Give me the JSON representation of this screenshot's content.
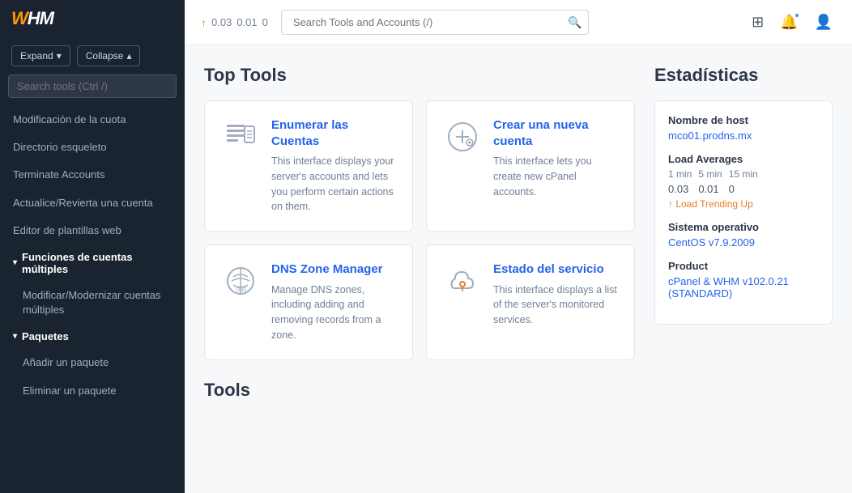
{
  "sidebar": {
    "logo": "WHM",
    "expand_label": "Expand",
    "collapse_label": "Collapse",
    "search_placeholder": "Search tools (Ctrl /)",
    "nav_items": [
      {
        "id": "modificacion-cuota",
        "label": "Modificación de la cuota",
        "type": "item"
      },
      {
        "id": "directorio-esqueleto",
        "label": "Directorio esqueleto",
        "type": "item"
      },
      {
        "id": "terminate-accounts",
        "label": "Terminate Accounts",
        "type": "item"
      },
      {
        "id": "actualice-revierta",
        "label": "Actualice/Revierta una cuenta",
        "type": "item"
      },
      {
        "id": "editor-plantillas",
        "label": "Editor de plantillas web",
        "type": "item"
      },
      {
        "id": "funciones-cuentas-multiples",
        "label": "Funciones de cuentas múltiples",
        "type": "section",
        "expanded": true
      },
      {
        "id": "modificar-modernizar",
        "label": "Modificar/Modernizar cuentas múltiples",
        "type": "item"
      },
      {
        "id": "paquetes",
        "label": "Paquetes",
        "type": "section",
        "expanded": true
      },
      {
        "id": "anadir-paquete",
        "label": "Añadir un paquete",
        "type": "item"
      },
      {
        "id": "eliminar-paquete",
        "label": "Eliminar un paquete",
        "type": "item"
      }
    ]
  },
  "topbar": {
    "load_arrow": "↑",
    "load_1min": "0.03",
    "load_5min": "0.01",
    "load_15min": "0",
    "search_placeholder": "Search Tools and Accounts (/)"
  },
  "top_tools": {
    "title": "Top Tools",
    "cards": [
      {
        "id": "enumerar-cuentas",
        "title": "Enumerar las Cuentas",
        "description": "This interface displays your server's accounts and lets you perform certain actions on them.",
        "icon": "list-icon"
      },
      {
        "id": "crear-cuenta",
        "title": "Crear una nueva cuenta",
        "description": "This interface lets you create new cPanel accounts.",
        "icon": "add-user-icon"
      },
      {
        "id": "dns-zone-manager",
        "title": "DNS Zone Manager",
        "description": "Manage DNS zones, including adding and removing records from a zone.",
        "icon": "dns-icon"
      },
      {
        "id": "estado-servicio",
        "title": "Estado del servicio",
        "description": "This interface displays a list of the server's monitored services.",
        "icon": "cloud-icon"
      }
    ]
  },
  "bottom_tools": {
    "title": "Tools"
  },
  "stats": {
    "title": "Estadísticas",
    "hostname_label": "Nombre de host",
    "hostname_value": "mco01.prodns.mx",
    "load_averages_label": "Load Averages",
    "load_1min_label": "1 min",
    "load_5min_label": "5 min",
    "load_15min_label": "15 min",
    "load_1min_value": "0.03",
    "load_5min_value": "0.01",
    "load_15min_value": "0",
    "load_trending": "↑ Load Trending Up",
    "so_label": "Sistema operativo",
    "so_value": "CentOS v7.9.2009",
    "product_label": "Product",
    "product_value": "cPanel & WHM v102.0.21 (STANDARD)"
  }
}
